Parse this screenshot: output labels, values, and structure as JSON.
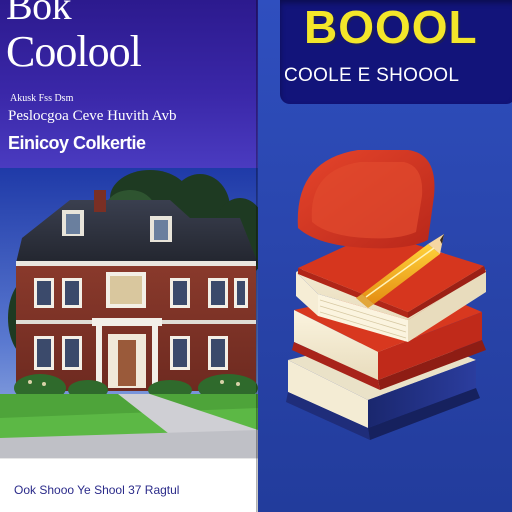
{
  "left_cover": {
    "title_line1": "Bok",
    "title_line2": "Coolool",
    "subtitle_line1": "Akusk Fss Dsm",
    "subtitle_line2": "Peslocgoa Ceve Huvith Avb",
    "author": "Einicoy Colkertie",
    "footer": "Ook Shooo Ye Shool 37 Ragtul"
  },
  "right_cover": {
    "title": "BOOOL",
    "subtitle": "COOLE E SHOOOL"
  },
  "colors": {
    "left_header": "#3a27a8",
    "right_background": "#2b47b2",
    "title_yellow": "#f3e62a",
    "book_red": "#d0321f",
    "book_navy": "#1f2d7a",
    "pencil_orange": "#f2a81b"
  },
  "icons": [
    "house-illustration",
    "book-stack-illustration",
    "pencil-illustration"
  ]
}
